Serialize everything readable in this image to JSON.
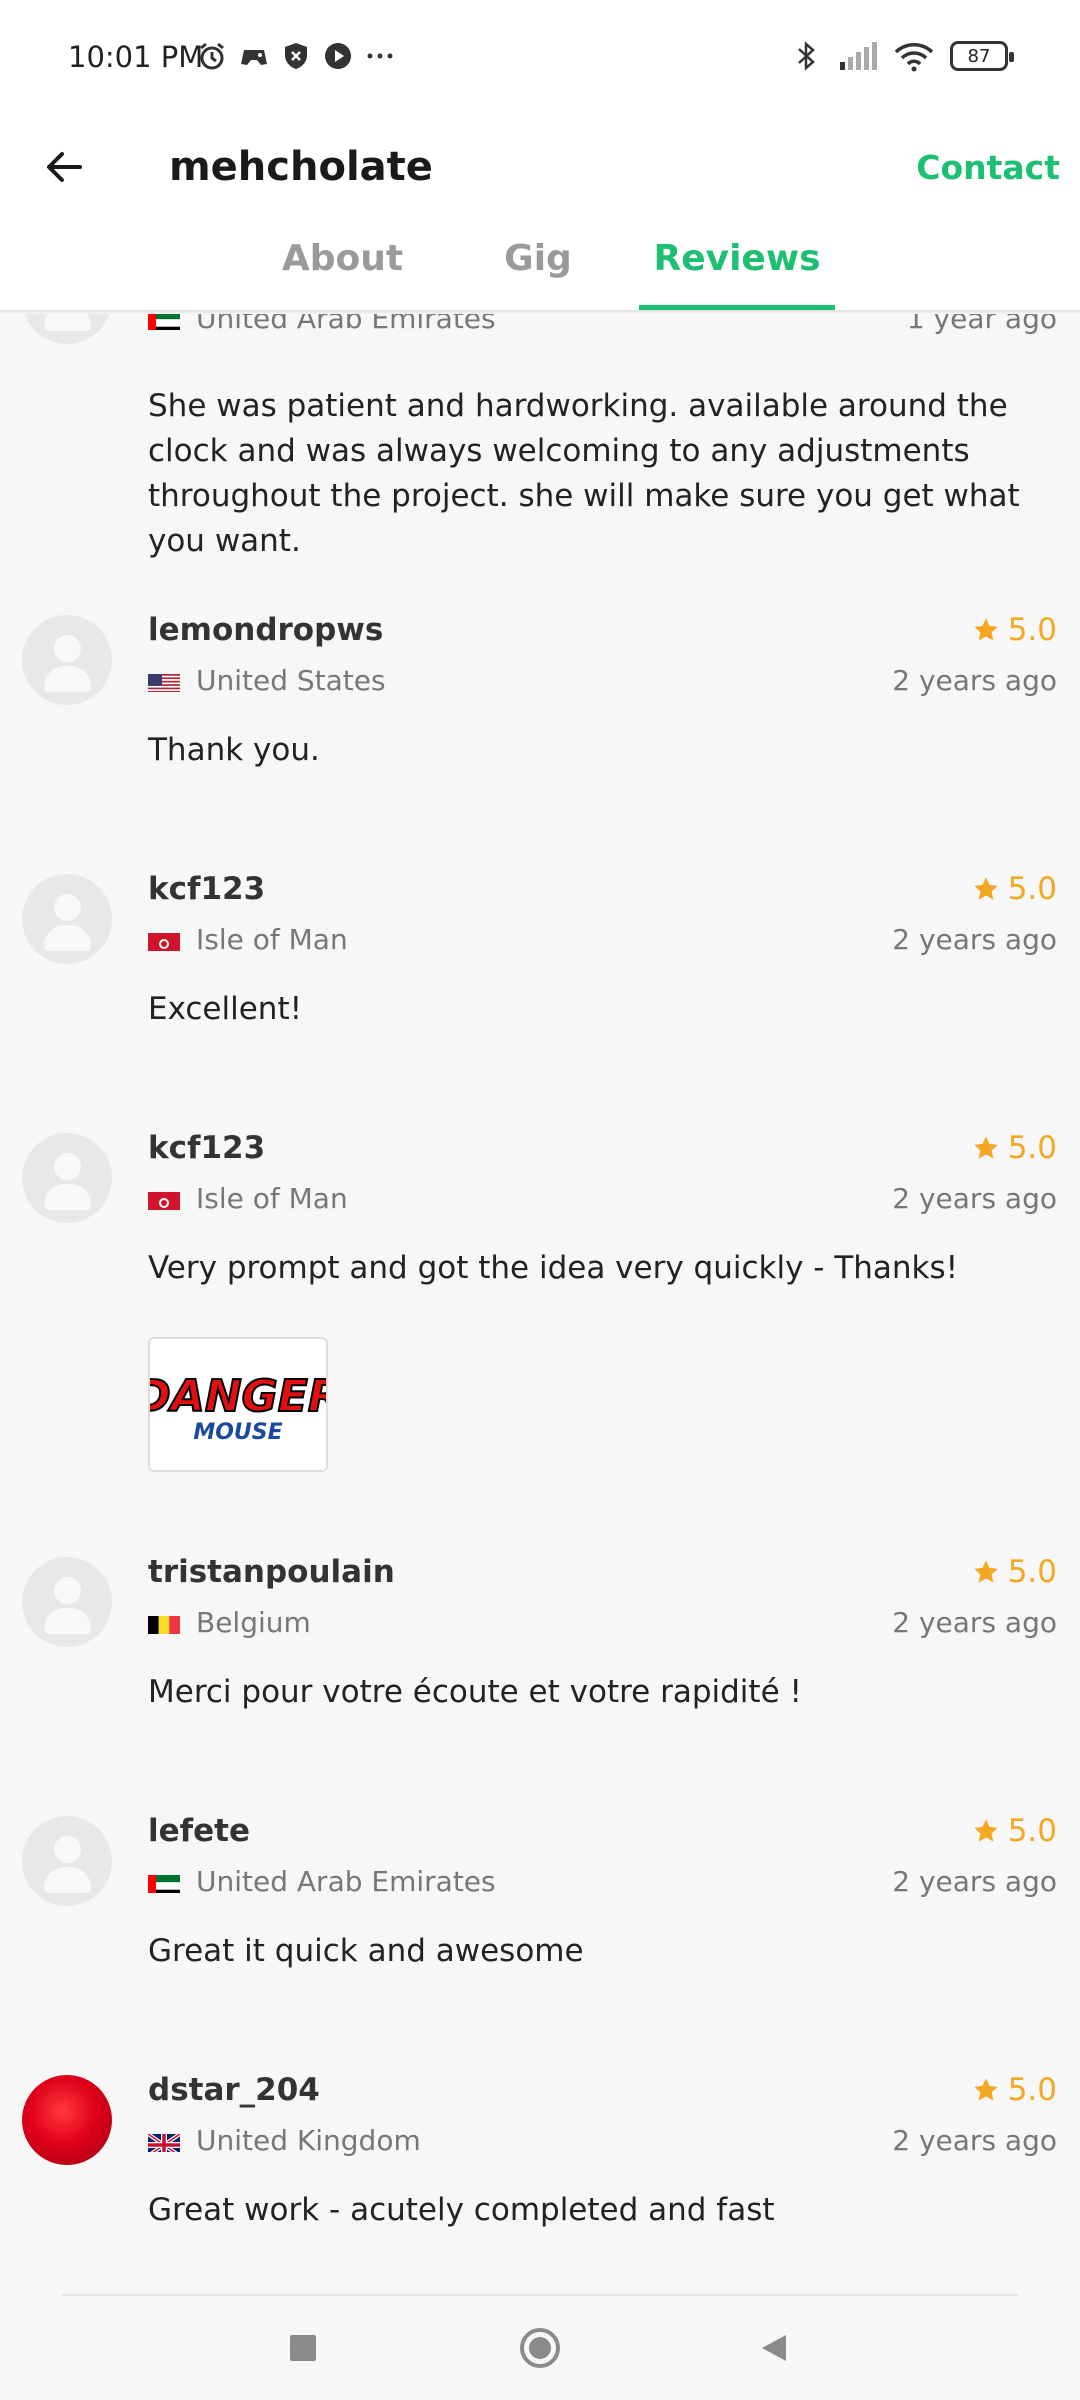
{
  "status": {
    "time": "10:01 PM",
    "battery": "87"
  },
  "header": {
    "title": "mehcholate",
    "contact_label": "Contact"
  },
  "tabs": [
    {
      "label": "About"
    },
    {
      "label": "Gig"
    },
    {
      "label": "Reviews"
    }
  ],
  "reviews": [
    {
      "name": "",
      "rating": "",
      "country": "United Arab Emirates",
      "time": "1 year ago",
      "text": "She was patient and hardworking. available around the clock and was always welcoming to any adjustments throughout the project. she will make sure you get what you want."
    },
    {
      "name": "lemondropws",
      "rating": "5.0",
      "country": "United States",
      "time": "2 years ago",
      "text": "Thank you."
    },
    {
      "name": "kcf123",
      "rating": "5.0",
      "country": "Isle of Man",
      "time": "2 years ago",
      "text": "Excellent!"
    },
    {
      "name": "kcf123",
      "rating": "5.0",
      "country": "Isle of Man",
      "time": "2 years ago",
      "text": "Very prompt and got the idea very quickly - Thanks!",
      "image_text_top": "DANGER",
      "image_text_bottom": "MOUSE"
    },
    {
      "name": "tristanpoulain",
      "rating": "5.0",
      "country": "Belgium",
      "time": "2 years ago",
      "text": "Merci pour votre écoute et votre rapidité !"
    },
    {
      "name": "lefete",
      "rating": "5.0",
      "country": "United Arab Emirates",
      "time": "2 years ago",
      "text": "Great it quick and awesome"
    },
    {
      "name": "dstar_204",
      "rating": "5.0",
      "country": "United Kingdom",
      "time": "2 years ago",
      "text": "Great work - acutely completed and fast"
    }
  ],
  "colors": {
    "accent": "#1dbf73",
    "star": "#f3a723"
  }
}
